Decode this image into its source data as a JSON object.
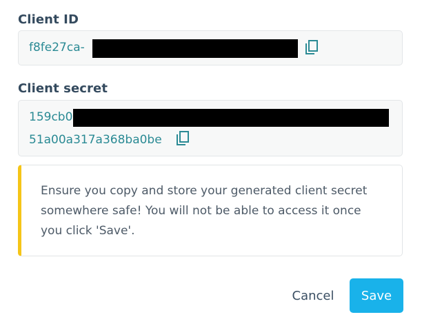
{
  "client_id": {
    "label": "Client ID",
    "value_visible": "f8fe27ca-",
    "copy_icon": "copy-icon"
  },
  "client_secret": {
    "label": "Client secret",
    "line1_visible": "159cb0",
    "line2": "51a00a317a368ba0be",
    "copy_icon": "copy-icon"
  },
  "notice": {
    "text": "Ensure you copy and store your generated client secret somewhere safe! You will not be able to access it once you click 'Save'.",
    "accent_color": "#f5c518"
  },
  "actions": {
    "cancel_label": "Cancel",
    "save_label": "Save",
    "save_color": "#19b2ea"
  }
}
